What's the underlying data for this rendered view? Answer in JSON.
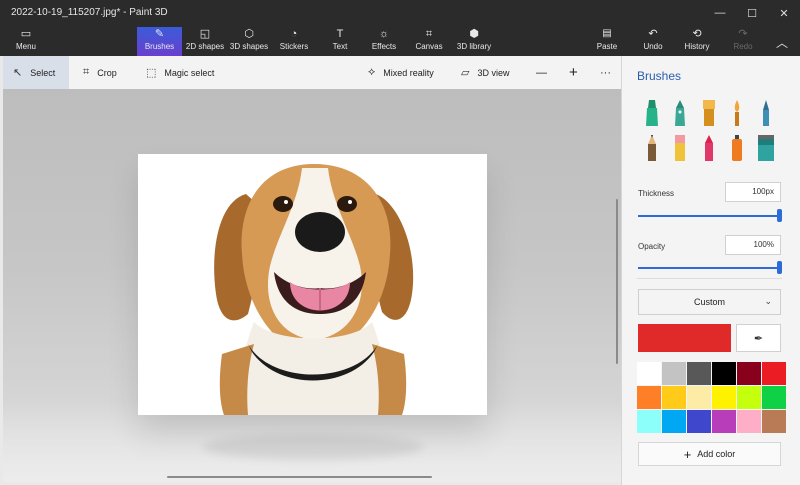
{
  "window": {
    "title": "2022-10-19_115207.jpg* - Paint 3D",
    "controls": [
      "—",
      "☐",
      "✕"
    ]
  },
  "ribbon": {
    "menu_label": "Menu",
    "tools": [
      {
        "label": "Brushes",
        "icon": "brush-icon",
        "glyph": "✎"
      },
      {
        "label": "2D shapes",
        "icon": "2d-shapes-icon",
        "glyph": "◱"
      },
      {
        "label": "3D shapes",
        "icon": "3d-shapes-icon",
        "glyph": "⬡"
      },
      {
        "label": "Stickers",
        "icon": "stickers-icon",
        "glyph": "◔"
      },
      {
        "label": "Text",
        "icon": "text-icon",
        "glyph": "T"
      },
      {
        "label": "Effects",
        "icon": "effects-icon",
        "glyph": "☼"
      },
      {
        "label": "Canvas",
        "icon": "canvas-icon",
        "glyph": "⌗"
      },
      {
        "label": "3D library",
        "icon": "3d-library-icon",
        "glyph": "⬢"
      }
    ],
    "actions": [
      {
        "label": "Paste",
        "icon": "paste-icon",
        "glyph": "📋"
      },
      {
        "label": "Undo",
        "icon": "undo-icon",
        "glyph": "↶"
      },
      {
        "label": "History",
        "icon": "history-icon",
        "glyph": "⟲"
      },
      {
        "label": "Redo",
        "icon": "redo-icon",
        "glyph": "↷"
      }
    ],
    "collapse_glyph": "︿"
  },
  "commandbar": {
    "select": "Select",
    "crop": "Crop",
    "magic_select": "Magic select",
    "mixed_reality": "Mixed reality",
    "view_3d": "3D view",
    "zoom_out": "—",
    "zoom_in": "+",
    "more": "···"
  },
  "panel": {
    "title": "Brushes",
    "thickness_label": "Thickness",
    "thickness_value": "100px",
    "thickness_level": 1.0,
    "opacity_label": "Opacity",
    "opacity_value": "100%",
    "opacity_level": 1.0,
    "color_mode": "Custom",
    "selected_color": "#e02a2a",
    "add_color": "Add color",
    "palette": [
      "#ffffff",
      "#c3c3c3",
      "#585858",
      "#000000",
      "#88001b",
      "#ec1c24",
      "#ff7f27",
      "#ffca18",
      "#fdeca6",
      "#fff200",
      "#c4ff0e",
      "#0ed145",
      "#8cfffb",
      "#00a8f3",
      "#3f48cc",
      "#b83dba",
      "#ffaec8",
      "#b97a56"
    ]
  }
}
